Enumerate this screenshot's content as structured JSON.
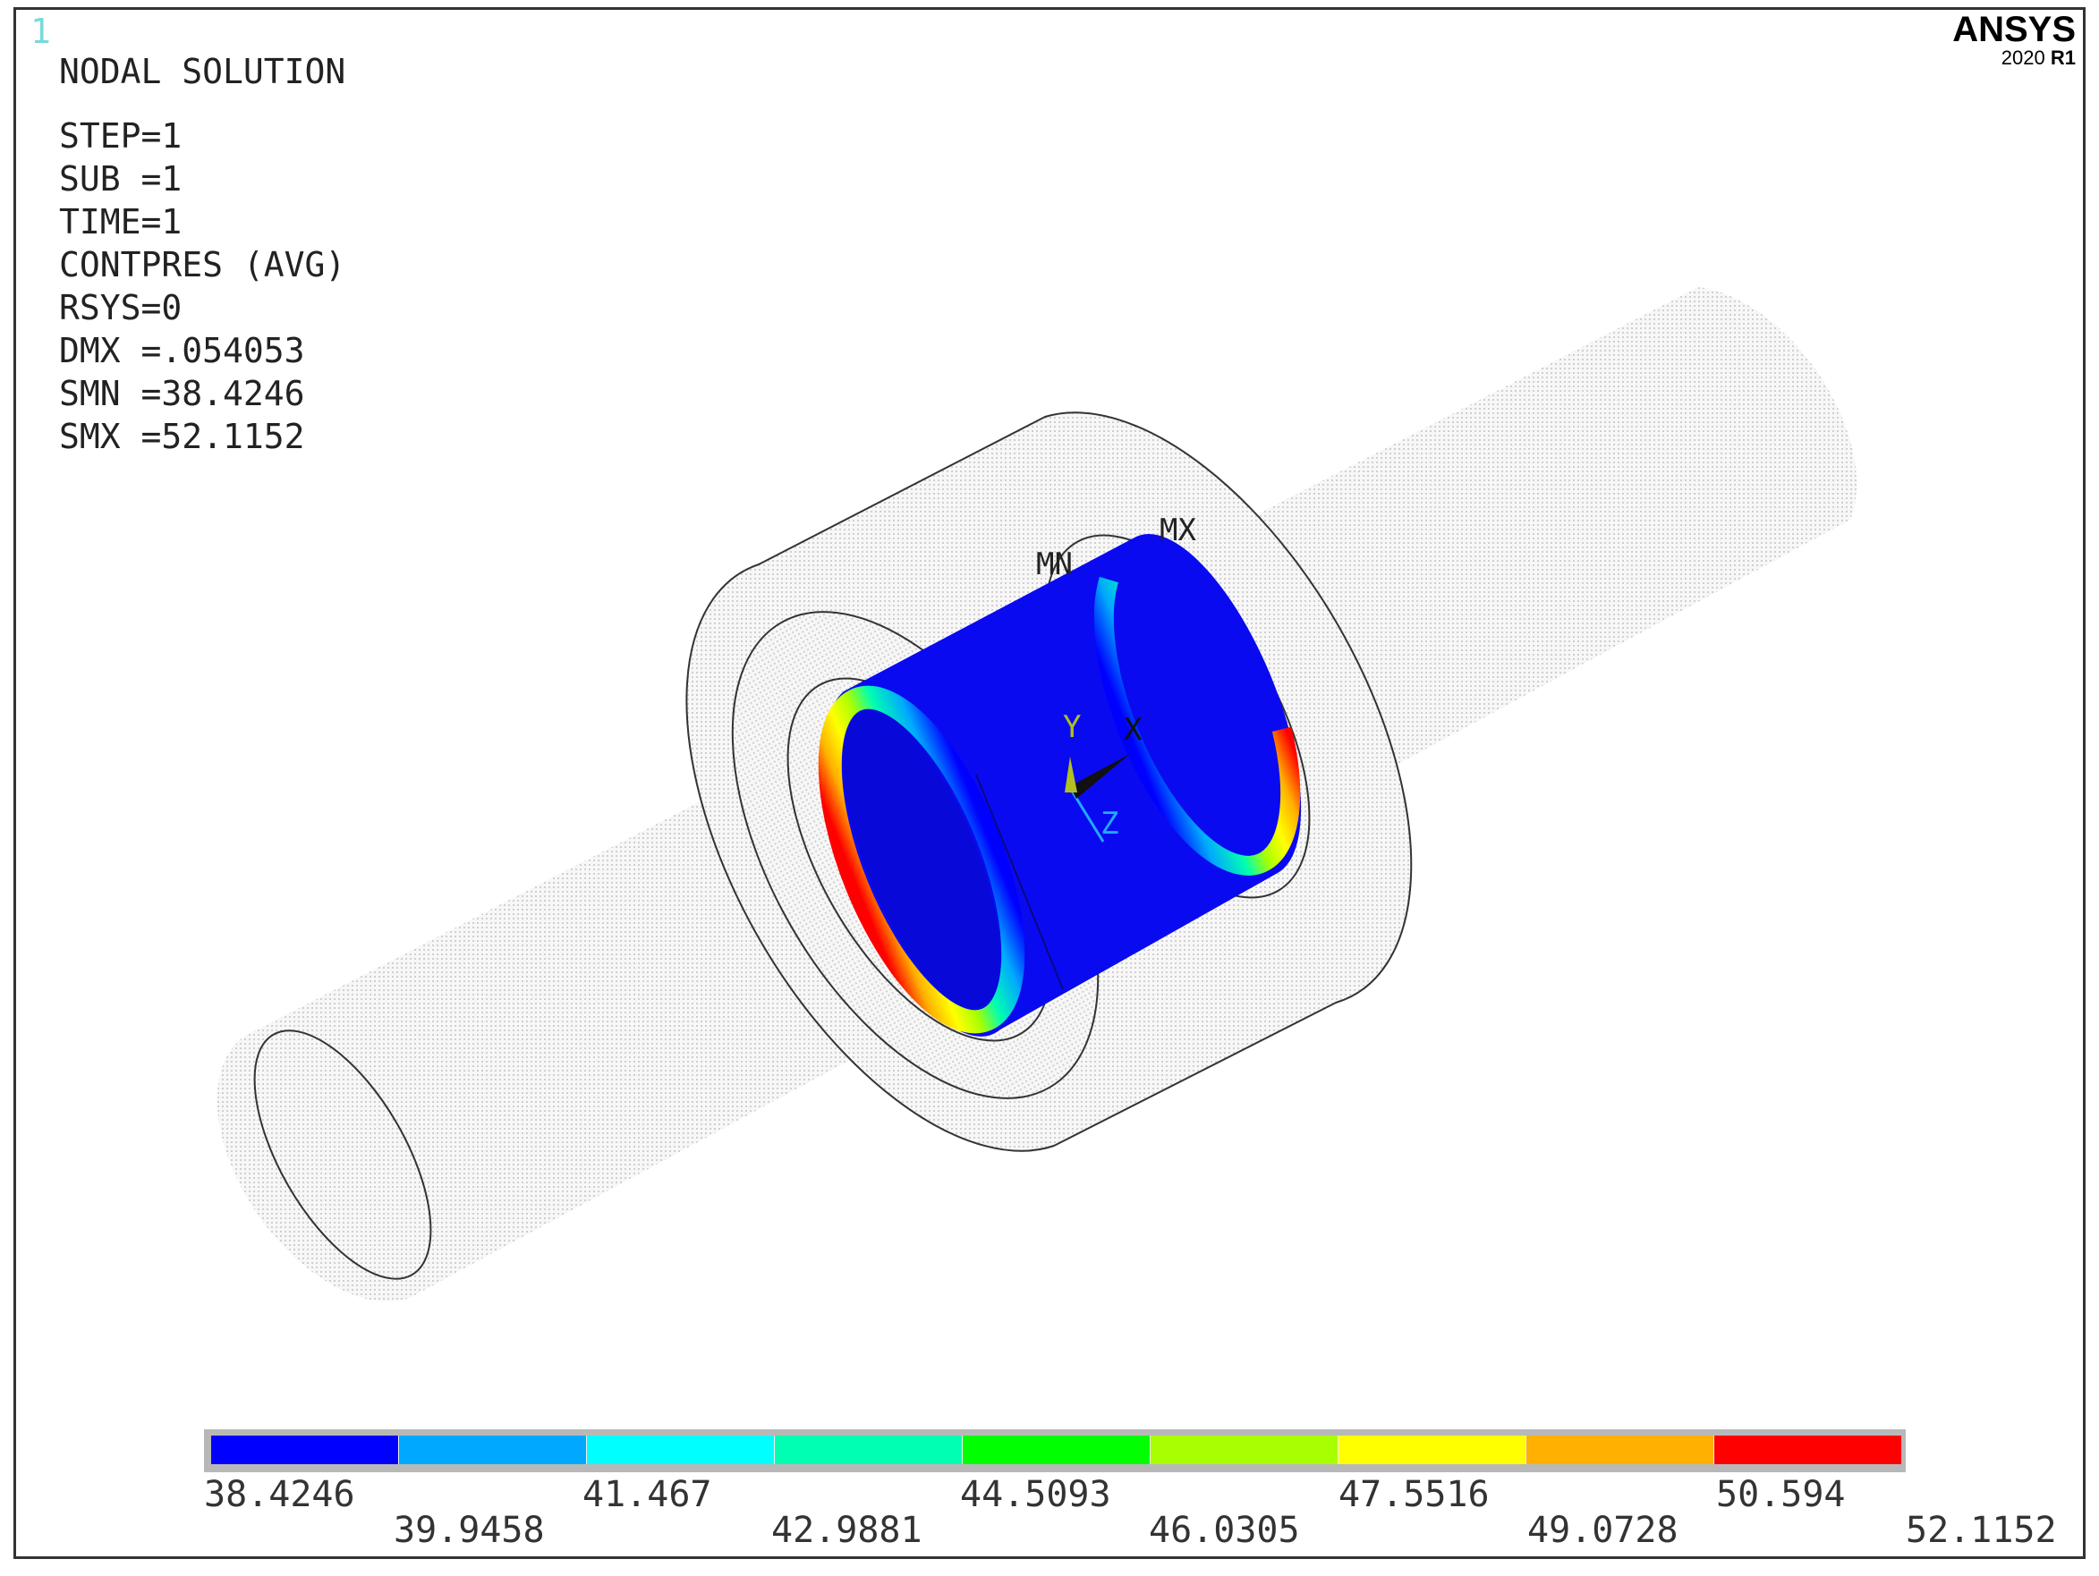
{
  "window": {
    "number": "1"
  },
  "brand": {
    "name": "ANSYS",
    "version_year": "2020",
    "version_release": "R1"
  },
  "info": {
    "title": "NODAL SOLUTION",
    "lines": [
      "STEP=1",
      "SUB =1",
      "TIME=1",
      "CONTPRES (AVG)",
      "RSYS=0",
      "DMX =.054053",
      "SMN =38.4246",
      "SMX =52.1152"
    ]
  },
  "markers": {
    "min": "MN",
    "max": "MX"
  },
  "triad": {
    "x": "X",
    "y": "Y",
    "z": "Z"
  },
  "legend": {
    "colors": [
      "#0000ff",
      "#00a8ff",
      "#00ffff",
      "#00ffb0",
      "#00ff00",
      "#a8ff00",
      "#ffff00",
      "#ffb000",
      "#ff0000"
    ],
    "labels": [
      "38.4246",
      "39.9458",
      "41.467",
      "42.9881",
      "44.5093",
      "46.0305",
      "47.5516",
      "49.0728",
      "50.594",
      "52.1152"
    ]
  }
}
